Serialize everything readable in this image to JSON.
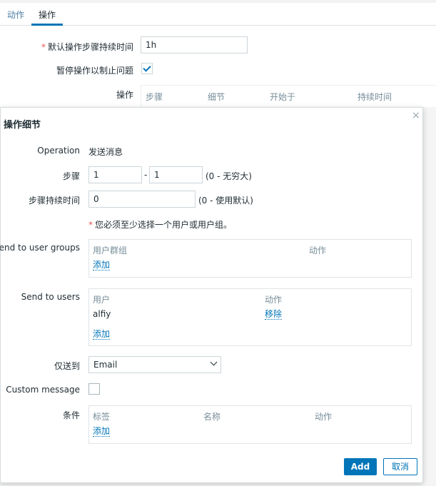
{
  "tabs": {
    "action": "动作",
    "operation": "操作"
  },
  "background": {
    "default_duration_label": "默认操作步骤持续时间",
    "default_duration_value": "1h",
    "pause_label": "暂停操作以制止问题",
    "pause_checked": true,
    "operations_label": "操作",
    "ops_headers": [
      "步骤",
      "细节",
      "开始于",
      "持续时间"
    ]
  },
  "dialog": {
    "title": "操作细节",
    "close": "×",
    "operation_label": "Operation",
    "operation_value": "发送消息",
    "steps_label": "步骤",
    "step_from": "1",
    "step_sep": "-",
    "step_to": "1",
    "steps_hint": "(0 - 无穷大)",
    "step_duration_label": "步骤持续时间",
    "step_duration_value": "0",
    "step_duration_hint": "(0 - 使用默认)",
    "required_note_star": "*",
    "required_note": "您必须至少选择一个用户或用户组。",
    "user_groups": {
      "label": "Send to user groups",
      "col_group": "用户群组",
      "col_action": "动作",
      "add": "添加"
    },
    "users": {
      "label": "Send to users",
      "col_user": "用户",
      "col_action": "动作",
      "rows": [
        {
          "user": "alfiy",
          "action": "移除"
        }
      ],
      "add": "添加"
    },
    "send_only_to": {
      "label": "仅送到",
      "selected": "Email"
    },
    "custom_message": {
      "label": "Custom message",
      "checked": false
    },
    "conditions": {
      "label": "条件",
      "col_tag": "标签",
      "col_name": "名称",
      "col_action": "动作",
      "add": "添加"
    },
    "add_button": "Add",
    "cancel_button": "取消"
  },
  "colors": {
    "accent": "#0275b8",
    "required": "#e45959",
    "muted": "#768d99"
  }
}
